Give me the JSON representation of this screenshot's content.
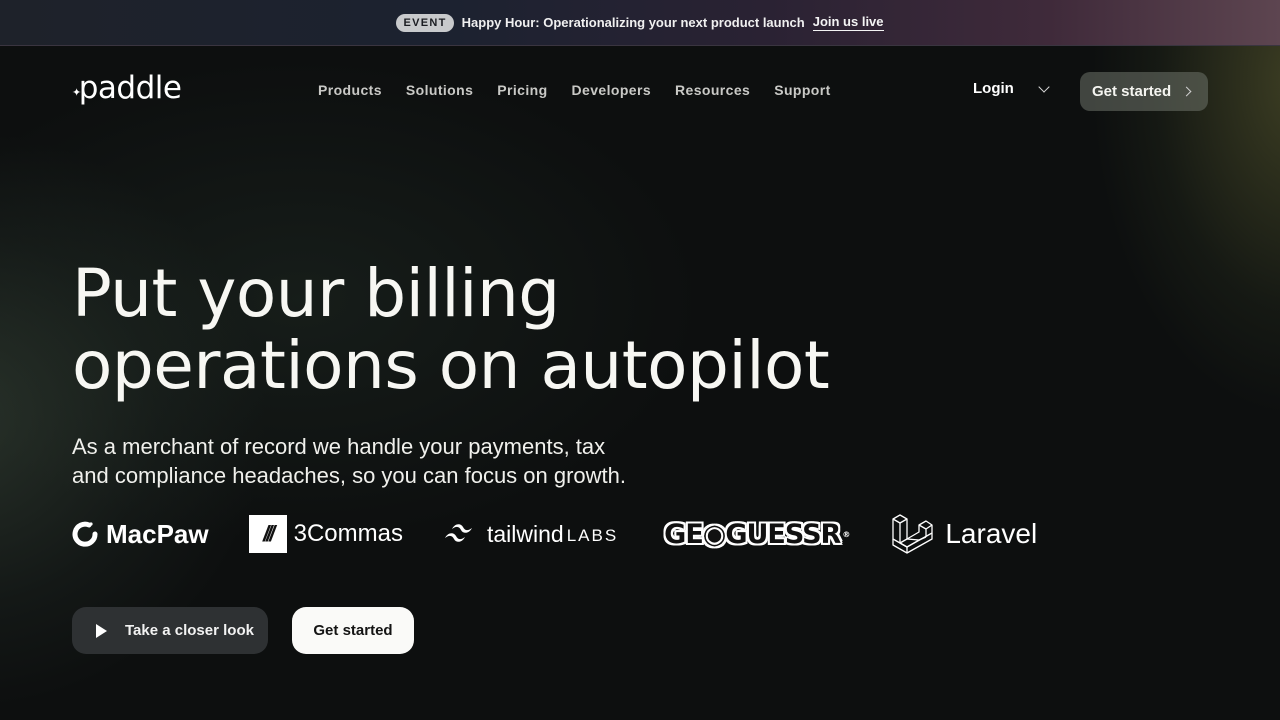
{
  "banner": {
    "badge": "EVENT",
    "text": "Happy Hour: Operationalizing your next product launch",
    "link": "Join us live"
  },
  "nav": {
    "logo": "paddle",
    "menu": [
      "Products",
      "Solutions",
      "Pricing",
      "Developers",
      "Resources",
      "Support"
    ],
    "login": "Login",
    "cta": "Get started"
  },
  "hero": {
    "title_line1": "Put your billing",
    "title_line2": "operations on autopilot",
    "subtitle_line1": "As a merchant of record we handle your payments, tax",
    "subtitle_line2": "and compliance headaches, so you can focus on growth."
  },
  "logos": {
    "macpaw": "MacPaw",
    "threecommas_mark": "///",
    "threecommas": "3Commas",
    "tailwind": "tailwind",
    "tailwind_labs": "LABS",
    "geoguessr": "GE◉GUESSR",
    "geoguessr_mark": "®",
    "laravel": "Laravel"
  },
  "buttons": {
    "closer_look": "Take a closer look",
    "get_started": "Get started"
  }
}
